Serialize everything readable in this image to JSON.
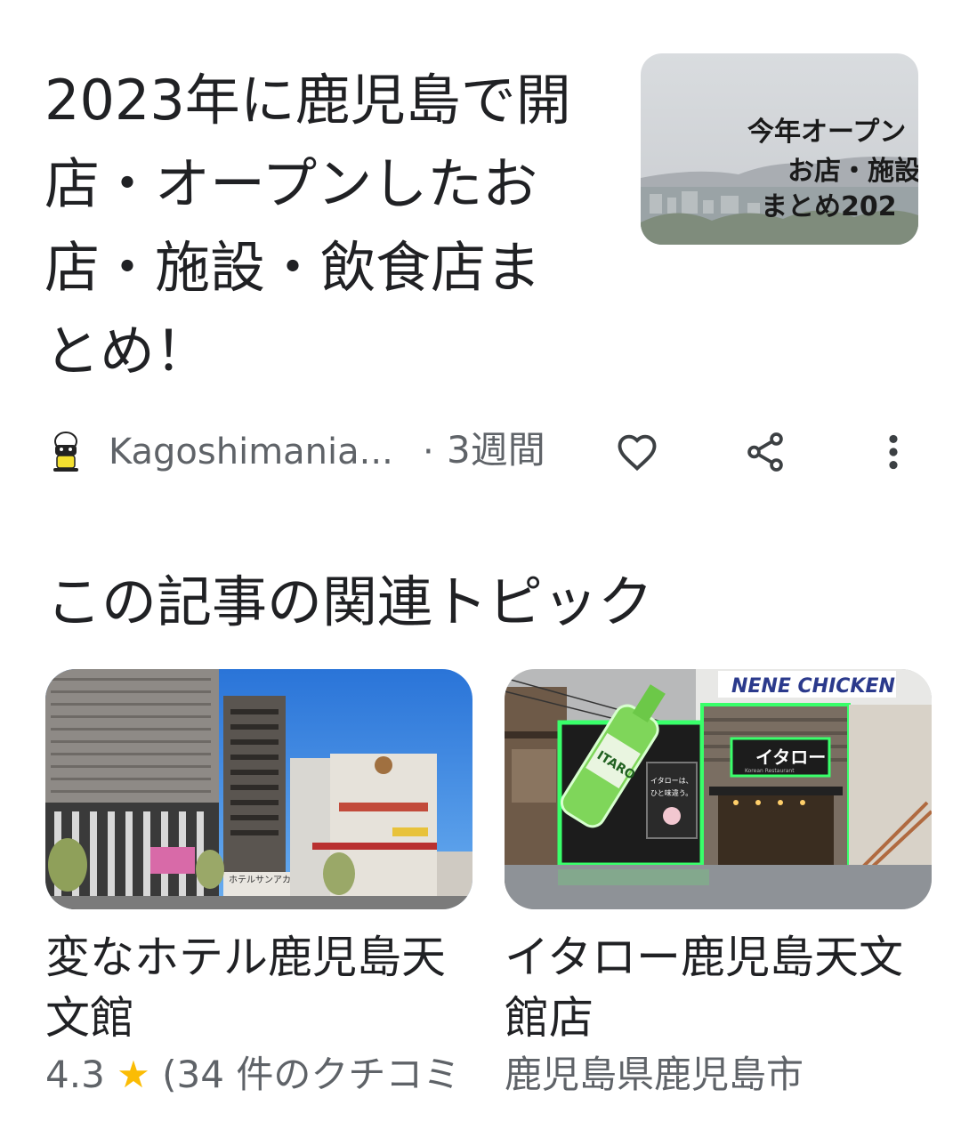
{
  "article": {
    "title": "2023年に鹿児島で開店・オープンしたお店・施設・飲食店まとめ！",
    "thumbnail": {
      "lines": [
        "今年オープン",
        "お店・施設",
        "まとめ202"
      ]
    },
    "source_name": "Kagoshimania...",
    "separator": "·",
    "age": "3週間",
    "icons": {
      "like": "heart-icon",
      "share": "share-icon",
      "more": "more-vert-icon"
    }
  },
  "related": {
    "heading": "この記事の関連トピック",
    "cards": [
      {
        "title": "変なホテル鹿児島天文館",
        "rating": "4.3",
        "star": "★",
        "reviews": "(34 件のクチコミ",
        "photo_sign": "ホテルサンアカ"
      },
      {
        "title": "イタロー鹿児島天文館店",
        "location": "鹿児島県鹿児島市",
        "photo_signs": {
          "brand": "NENE CHICKEN",
          "shop": "イタロー",
          "shop_sub": "Korean Restaurant",
          "bottle": "ITARO",
          "panel_line1": "イタローは、",
          "panel_line2": "ひと味違う。"
        }
      }
    ]
  },
  "colors": {
    "text_primary": "#202124",
    "text_secondary": "#5f6368",
    "star": "#fbbc04",
    "neon_green": "#39ff6a",
    "sky_blue": "#3d8be0"
  }
}
